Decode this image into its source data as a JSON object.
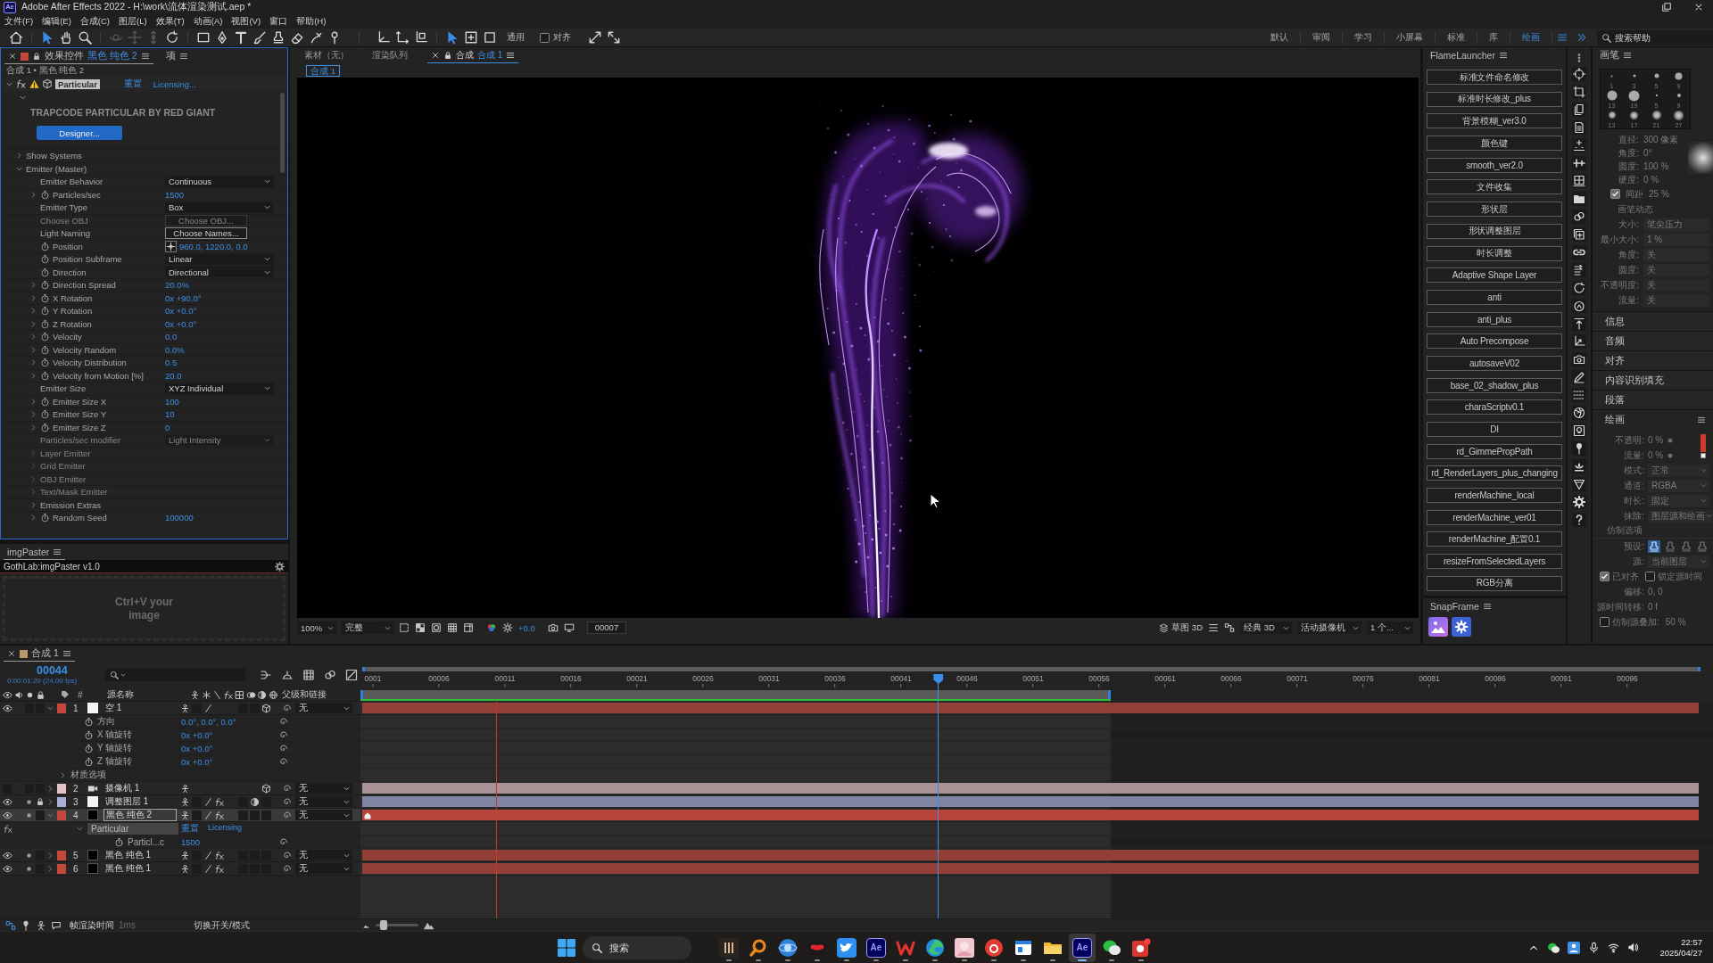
{
  "window": {
    "app_icon": "Ae",
    "title": "Adobe After Effects 2022 - H:\\work\\流体渲染测试.aep *"
  },
  "menu": [
    "文件(F)",
    "编辑(E)",
    "合成(C)",
    "图层(L)",
    "效果(T)",
    "动画(A)",
    "视图(V)",
    "窗口",
    "帮助(H)"
  ],
  "toolbar": {
    "tools": [
      {
        "selected": false,
        "disabled": false
      },
      {
        "selected": true,
        "disabled": false
      },
      {
        "selected": false,
        "disabled": false
      },
      {
        "selected": false,
        "disabled": false
      },
      {
        "selected": false,
        "disabled": true
      },
      {
        "selected": false,
        "disabled": true
      },
      {
        "selected": false,
        "disabled": true
      },
      {
        "selected": false,
        "disabled": false
      },
      {
        "selected": false,
        "disabled": false
      },
      {
        "selected": false,
        "disabled": false
      },
      {
        "selected": false,
        "disabled": false
      },
      {
        "selected": false,
        "disabled": false
      },
      {
        "selected": false,
        "disabled": false
      },
      {
        "selected": false,
        "disabled": false
      },
      {
        "selected": false,
        "disabled": false
      },
      {
        "selected": false,
        "disabled": false
      }
    ],
    "modes": [
      {
        "selected": true
      },
      {
        "selected": false
      },
      {
        "selected": false
      }
    ],
    "mode_label": "通用",
    "snap": {
      "label": "对齐",
      "checked": false
    },
    "workspaces": [
      {
        "label": "默认",
        "selected": false
      },
      {
        "label": "审阅",
        "selected": false
      },
      {
        "label": "学习",
        "selected": false
      },
      {
        "label": "小屏幕",
        "selected": false
      },
      {
        "label": "标准",
        "selected": false
      },
      {
        "label": "库",
        "selected": false
      },
      {
        "label": "绘画",
        "selected": true
      }
    ],
    "search": {
      "placeholder": "搜索帮助"
    }
  },
  "effect_controls": {
    "tabs": [
      {
        "label": "效果控件",
        "target": "黑色 纯色 2",
        "selected": true
      },
      {
        "label": "项",
        "selected": false
      }
    ],
    "breadcrumb": "合成 1 • 黑色 纯色 2",
    "effect": {
      "name": "Particular",
      "selected": true,
      "expanded": true,
      "reset": "重置",
      "status": "Licensing...",
      "ui_expanded": true,
      "banner": "TRAPCODE PARTICULAR BY RED GIANT",
      "designer": "Designer..."
    },
    "properties": [
      {
        "label": "Show Systems",
        "kind": "group",
        "expanded": false,
        "stopwatch": false,
        "disabled": false
      },
      {
        "label": "Emitter (Master)",
        "kind": "group",
        "expanded": true,
        "stopwatch": false,
        "disabled": false,
        "children": [
          {
            "label": "Emitter Behavior",
            "kind": "dropdown",
            "value": "Continuous",
            "expandable": false,
            "stopwatch": false,
            "disabled": false
          },
          {
            "label": "Particles/sec",
            "kind": "value",
            "value": "1500",
            "expandable": true,
            "expanded": false,
            "stopwatch": true,
            "disabled": false
          },
          {
            "label": "Emitter Type",
            "kind": "dropdown",
            "value": "Box",
            "expandable": false,
            "stopwatch": false,
            "disabled": false
          },
          {
            "label": "Choose OBJ",
            "kind": "button",
            "value": "Choose OBJ...",
            "expandable": false,
            "stopwatch": false,
            "disabled": true
          },
          {
            "label": "Light Naming",
            "kind": "button",
            "value": "Choose Names...",
            "expandable": false,
            "stopwatch": false,
            "disabled": false
          },
          {
            "label": "Position",
            "kind": "point",
            "value": "960.0, 1220.0, 0.0",
            "expandable": false,
            "stopwatch": true,
            "disabled": false
          },
          {
            "label": "Position Subframe",
            "kind": "dropdown",
            "value": "Linear",
            "expandable": false,
            "stopwatch": true,
            "disabled": false
          },
          {
            "label": "Direction",
            "kind": "dropdown",
            "value": "Directional",
            "expandable": false,
            "stopwatch": true,
            "disabled": false
          },
          {
            "label": "Direction Spread",
            "kind": "value",
            "value": "20.0%",
            "expandable": true,
            "expanded": false,
            "stopwatch": true,
            "disabled": false
          },
          {
            "label": "X Rotation",
            "kind": "value",
            "value": "0x +90.0°",
            "expandable": true,
            "expanded": false,
            "stopwatch": true,
            "disabled": false
          },
          {
            "label": "Y Rotation",
            "kind": "value",
            "value": "0x +0.0°",
            "expandable": true,
            "expanded": false,
            "stopwatch": true,
            "disabled": false
          },
          {
            "label": "Z Rotation",
            "kind": "value",
            "value": "0x +0.0°",
            "expandable": true,
            "expanded": false,
            "stopwatch": true,
            "disabled": false
          },
          {
            "label": "Velocity",
            "kind": "value",
            "value": "0.0",
            "expandable": true,
            "expanded": false,
            "stopwatch": true,
            "disabled": false
          },
          {
            "label": "Velocity Random",
            "kind": "value",
            "value": "0.0%",
            "expandable": true,
            "expanded": false,
            "stopwatch": true,
            "disabled": false
          },
          {
            "label": "Velocity Distribution",
            "kind": "value",
            "value": "0.5",
            "expandable": true,
            "expanded": false,
            "stopwatch": true,
            "disabled": false
          },
          {
            "label": "Velocity from Motion [%]",
            "kind": "value",
            "value": "20.0",
            "expandable": true,
            "expanded": false,
            "stopwatch": true,
            "disabled": false
          },
          {
            "label": "Emitter Size",
            "kind": "dropdown",
            "value": "XYZ Individual",
            "expandable": false,
            "stopwatch": false,
            "disabled": false
          },
          {
            "label": "Emitter Size X",
            "kind": "value",
            "value": "100",
            "expandable": true,
            "expanded": false,
            "stopwatch": true,
            "disabled": false
          },
          {
            "label": "Emitter Size Y",
            "kind": "value",
            "value": "10",
            "expandable": true,
            "expanded": false,
            "stopwatch": true,
            "disabled": false
          },
          {
            "label": "Emitter Size Z",
            "kind": "value",
            "value": "0",
            "expandable": true,
            "expanded": false,
            "stopwatch": true,
            "disabled": false
          },
          {
            "label": "Particles/sec modifier",
            "kind": "dropdown",
            "value": "Light Intensity",
            "expandable": false,
            "stopwatch": false,
            "disabled": true
          },
          {
            "label": "Layer Emitter",
            "kind": "group",
            "expanded": false,
            "stopwatch": false,
            "disabled": true
          },
          {
            "label": "Grid Emitter",
            "kind": "group",
            "expanded": false,
            "stopwatch": false,
            "disabled": true
          },
          {
            "label": "OBJ Emitter",
            "kind": "group",
            "expanded": false,
            "stopwatch": false,
            "disabled": true
          },
          {
            "label": "Text/Mask Emitter",
            "kind": "group",
            "expanded": false,
            "stopwatch": false,
            "disabled": true
          },
          {
            "label": "Emission Extras",
            "kind": "group",
            "expanded": false,
            "stopwatch": false,
            "disabled": false
          },
          {
            "label": "Random Seed",
            "kind": "value",
            "value": "100000",
            "expandable": true,
            "expanded": false,
            "stopwatch": true,
            "disabled": false
          }
        ]
      }
    ]
  },
  "img_paster": {
    "tab": "imgPaster",
    "title": "GothLab:imgPaster v1.0",
    "hint": "Ctrl+V your image"
  },
  "viewer": {
    "tabs": [
      {
        "label": "素材（无）",
        "selected": false
      },
      {
        "label": "渲染队列",
        "selected": false
      },
      {
        "label": "合成",
        "name": "合成 1",
        "selected": true
      }
    ],
    "crumb": "合成 1",
    "bar": {
      "zoom": "100%",
      "resolution": "完整",
      "exposure": "+0.0",
      "timecode": "00007",
      "renderer": "草图 3D",
      "renderer_mode": "经典 3D",
      "camera": "活动摄像机",
      "views": "1 个..."
    }
  },
  "launcher": {
    "title": "FlameLauncher",
    "buttons": [
      "标准文件命名修改",
      "标准时长修改_plus",
      "背景模糊_ver3.0",
      "颜色键",
      "smooth_ver2.0",
      "文件收集",
      "形状层",
      "形状调整图层",
      "时长调整",
      "Adaptive Shape Layer",
      "anti",
      "anti_plus",
      "Auto Precompose",
      "autosaveV02",
      "base_02_shadow_plus",
      "charaScriptv0.1",
      "DI",
      "rd_GimmePropPath",
      "rd_RenderLayers_plus_changing",
      "renderMachine_local",
      "renderMachine_ver01",
      "renderMachine_配置0.1",
      "resizeFromSelectedLayers",
      "RGB分离"
    ]
  },
  "snapframe": {
    "title": "SnapFrame"
  },
  "brushes": {
    "title": "画笔",
    "tips": [
      {
        "size": "1",
        "kind": "hard"
      },
      {
        "size": "3",
        "kind": "hard"
      },
      {
        "size": "5",
        "kind": "hard"
      },
      {
        "size": "9",
        "kind": "hard"
      },
      {
        "size": "13",
        "kind": "hard"
      },
      {
        "size": "19",
        "kind": "hard"
      },
      {
        "size": "5",
        "kind": "soft"
      },
      {
        "size": "9",
        "kind": "soft"
      },
      {
        "size": "13",
        "kind": "soft"
      },
      {
        "size": "17",
        "kind": "soft"
      },
      {
        "size": "21",
        "kind": "soft"
      },
      {
        "size": "27",
        "kind": "soft"
      }
    ],
    "props": [
      {
        "label": "直径:",
        "value": "300 像素"
      },
      {
        "label": "角度:",
        "value": "0°"
      },
      {
        "label": "圆度:",
        "value": "100 %"
      },
      {
        "label": "硬度:",
        "value": "0 %"
      }
    ],
    "spacing": {
      "label": "间距",
      "value": "25 %",
      "checked": true
    },
    "dynamics_title": "画笔动态",
    "dynamics": [
      {
        "label": "大小:",
        "value": "笔尖压力"
      },
      {
        "label": "最小大小:",
        "value": "1 %"
      },
      {
        "label": "角度:",
        "value": "关"
      },
      {
        "label": "圆度:",
        "value": "关"
      },
      {
        "label": "不透明度:",
        "value": "关"
      },
      {
        "label": "流量:",
        "value": "关"
      }
    ]
  },
  "panels": [
    {
      "label": "信息",
      "expanded": false
    },
    {
      "label": "音频",
      "expanded": false
    },
    {
      "label": "对齐",
      "expanded": false
    },
    {
      "label": "内容识别填充",
      "expanded": false
    },
    {
      "label": "段落",
      "expanded": false
    },
    {
      "label": "绘画",
      "expanded": true
    }
  ],
  "paint": {
    "rows": [
      {
        "label": "不透明:",
        "value": "0 %",
        "kind": "slider"
      },
      {
        "label": "流量:",
        "value": "0 %",
        "kind": "slider"
      },
      {
        "label": "模式:",
        "value": "正常",
        "kind": "dropdown"
      },
      {
        "label": "通道:",
        "value": "RGBA",
        "kind": "dropdown"
      },
      {
        "label": "时长:",
        "value": "固定",
        "kind": "dropdown"
      },
      {
        "label": "抹除:",
        "value": "图层源和绘画",
        "kind": "dropdown"
      }
    ],
    "clone_title": "仿制选项",
    "presets_label": "预设:",
    "presets": [
      {
        "selected": true
      },
      {
        "selected": false
      },
      {
        "selected": false
      },
      {
        "selected": false
      }
    ],
    "source": {
      "label": "源:",
      "value": "当前图层"
    },
    "aligned": {
      "label": "已对齐",
      "checked": true
    },
    "lock_time": {
      "label": "锁定源时间",
      "checked": false
    },
    "offset": {
      "label": "偏移:",
      "value": "0, 0"
    },
    "time_shift": {
      "label": "源时间转移:",
      "value": "0 f"
    },
    "overlay": {
      "label": "仿制源叠加:",
      "value": "50 %",
      "checked": false
    }
  },
  "timeline": {
    "tab": "合成 1",
    "timecode": "00044",
    "fps": "0:00:01:20 (24.00 fps)",
    "columns": {
      "number": "#",
      "name": "源名称",
      "parent": "父级和链接"
    },
    "ruler": [
      "0001",
      "00006",
      "00011",
      "00016",
      "00021",
      "00026",
      "00031",
      "00036",
      "00041",
      "00046",
      "00051",
      "00056",
      "00061",
      "00066",
      "00071",
      "00076",
      "00081",
      "00086",
      "00091",
      "00096"
    ],
    "playhead": {
      "level": 0.427
    },
    "work_area": {
      "level": 0.555
    },
    "marker": {
      "level": 0.1
    },
    "layers": [
      {
        "number": "1",
        "name": "空 1",
        "kind": "null",
        "color": "#c4473c",
        "visible": true,
        "solo": false,
        "locked": false,
        "selected": false,
        "expanded": true,
        "parent": "无",
        "children": [
          {
            "kind": "property",
            "label": "方向",
            "value": "0.0°, 0.0°, 0.0°"
          },
          {
            "kind": "property",
            "label": "X 轴旋转",
            "value": "0x +0.0°"
          },
          {
            "kind": "property",
            "label": "Y 轴旋转",
            "value": "0x +0.0°"
          },
          {
            "kind": "property",
            "label": "Z 轴旋转",
            "value": "0x +0.0°"
          },
          {
            "kind": "group",
            "label": "材质选项",
            "expanded": false
          }
        ]
      },
      {
        "number": "2",
        "name": "摄像机 1",
        "kind": "camera",
        "color": "#e3c3c8",
        "visible": false,
        "solo": false,
        "locked": false,
        "selected": false,
        "expanded": false,
        "parent": "无"
      },
      {
        "number": "3",
        "name": "调整图层 1",
        "kind": "adjustment",
        "color": "#a9aed8",
        "visible": true,
        "solo": true,
        "locked": true,
        "selected": false,
        "expanded": false,
        "parent": "无"
      },
      {
        "number": "4",
        "name": "黑色 纯色 2",
        "kind": "solid",
        "color": "#c4473c",
        "visible": true,
        "solo": true,
        "locked": false,
        "selected": true,
        "expanded": true,
        "parent": "无",
        "children": [
          {
            "kind": "effect",
            "label": "Particular",
            "selected": true,
            "reset": "重置",
            "status": "Licensing",
            "expanded": true,
            "children": [
              {
                "kind": "property",
                "label": "Particl...c",
                "value": "1500"
              }
            ]
          }
        ]
      },
      {
        "number": "5",
        "name": "黑色 纯色 1",
        "kind": "solid",
        "color": "#c4473c",
        "visible": true,
        "solo": true,
        "locked": false,
        "selected": false,
        "expanded": false,
        "parent": "无"
      },
      {
        "number": "6",
        "name": "黑色 纯色 1",
        "kind": "solid",
        "color": "#c4473c",
        "visible": true,
        "solo": true,
        "locked": false,
        "selected": false,
        "expanded": false,
        "parent": "无"
      }
    ],
    "render_time": {
      "label": "帧渲染时间",
      "value": "1ms"
    },
    "toggle": "切换开关/模式",
    "zoom": {
      "level": 0.2
    }
  },
  "taskbar": {
    "search": {
      "placeholder": "搜索"
    },
    "apps": [
      {
        "active": false
      },
      {
        "active": false
      },
      {
        "active": false
      },
      {
        "active": false
      },
      {
        "active": false
      },
      {
        "active": false,
        "label": "Ae"
      },
      {
        "active": false
      },
      {
        "active": false
      },
      {
        "active": false
      },
      {
        "active": false
      },
      {
        "active": false
      },
      {
        "active": false
      },
      {
        "active": true,
        "label": "Ae"
      },
      {
        "active": false
      },
      {
        "active": false
      }
    ],
    "time": "22:57",
    "date": "2025/04/27"
  }
}
